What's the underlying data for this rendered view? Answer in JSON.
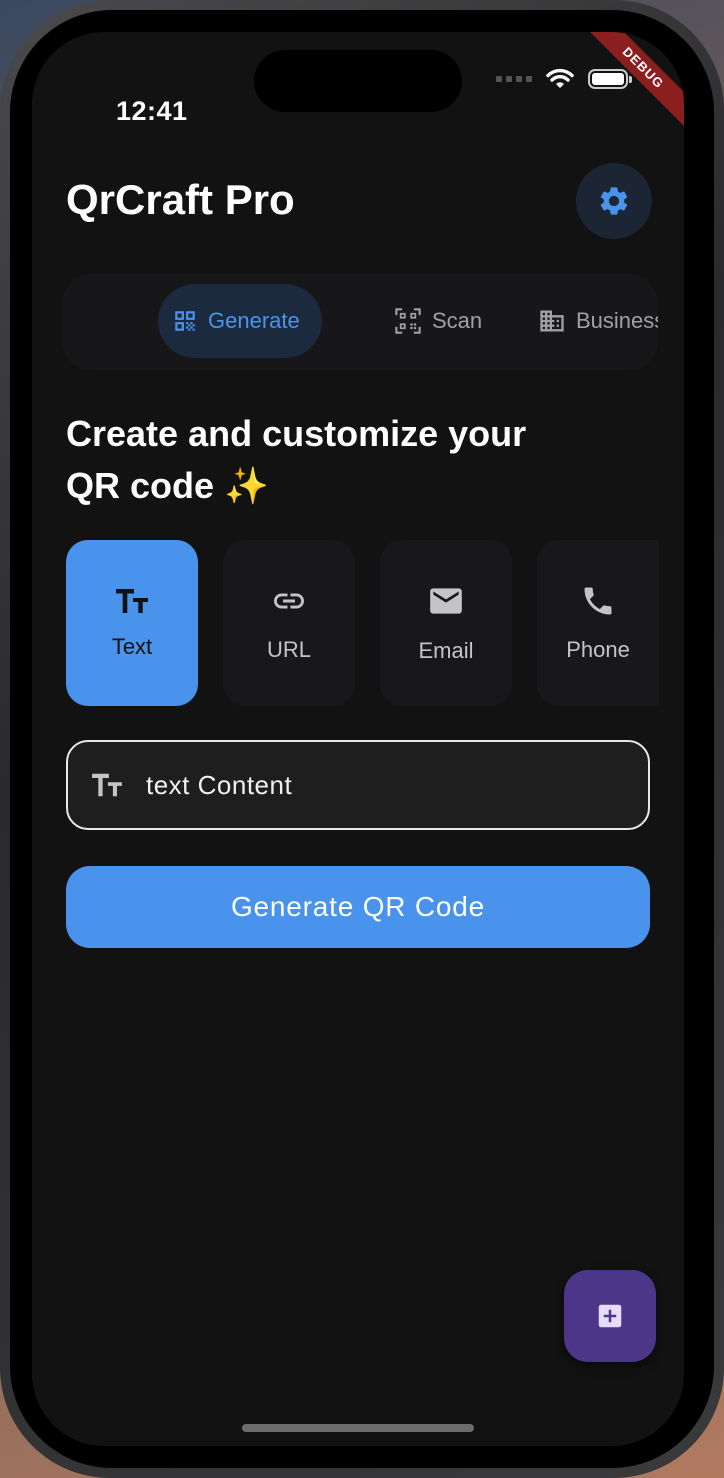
{
  "status_bar": {
    "time": "12:41",
    "debug_label": "DEBUG"
  },
  "app": {
    "title": "QrCraft Pro"
  },
  "tabs": [
    {
      "label": "Generate",
      "icon": "qr-code-icon",
      "active": true
    },
    {
      "label": "Scan",
      "icon": "qr-scan-icon",
      "active": false
    },
    {
      "label": "Business C",
      "icon": "building-icon",
      "active": false
    }
  ],
  "headline": "Create and customize your QR code ✨",
  "types": [
    {
      "label": "Text",
      "icon": "text-fields-icon",
      "active": true
    },
    {
      "label": "URL",
      "icon": "link-icon",
      "active": false
    },
    {
      "label": "Email",
      "icon": "email-icon",
      "active": false
    },
    {
      "label": "Phone",
      "icon": "phone-icon",
      "active": false
    }
  ],
  "input": {
    "placeholder": "text Content"
  },
  "generate_button": {
    "label": "Generate QR Code"
  },
  "colors": {
    "accent": "#4A93EC",
    "fab": "#4B3687",
    "background": "#121212"
  }
}
